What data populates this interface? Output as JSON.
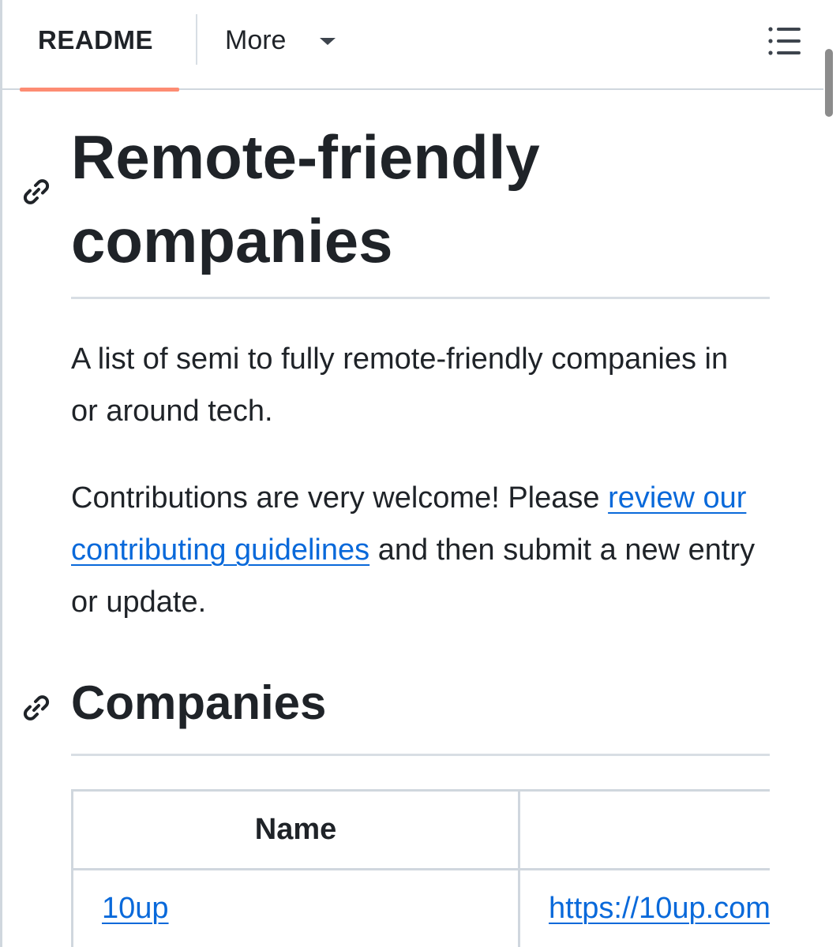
{
  "tabs": {
    "readme_label": "README",
    "more_label": "More"
  },
  "icons": {
    "toc": "list-unordered-icon",
    "anchor": "link-icon",
    "caret": "triangle-down-icon"
  },
  "colors": {
    "accent_underline": "#fd8c73",
    "link": "#0969da",
    "text": "#1f2328",
    "border": "#d0d7de"
  },
  "article": {
    "title": "Remote-friendly companies",
    "intro": "A list of semi to fully remote-friendly companies in or around tech.",
    "contrib_before": "Contributions are very welcome! Please ",
    "contrib_link": "review our contributing guidelines",
    "contrib_after": " and then submit a new entry or update.",
    "section_heading": "Companies"
  },
  "table": {
    "headers": [
      "Name",
      ""
    ],
    "rows": [
      [
        "10up",
        "https://10up.com"
      ]
    ]
  }
}
